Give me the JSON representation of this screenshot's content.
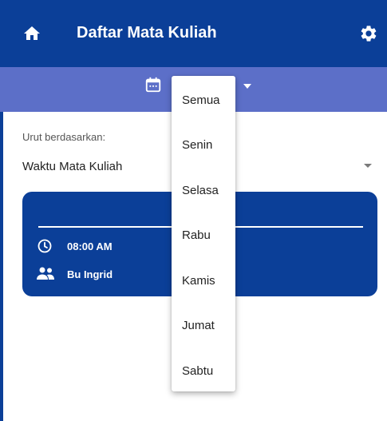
{
  "appbar": {
    "title": "Daftar Mata Kuliah",
    "home_icon": "home-icon",
    "settings_icon": "gear-icon"
  },
  "filter": {
    "icon": "calendar-icon",
    "selected_day": ""
  },
  "sort": {
    "label": "Urut berdasarkan:",
    "value": "Waktu Mata Kuliah"
  },
  "course_card": {
    "time": "08:00 AM",
    "lecturer": "Bu Ingrid",
    "time_icon": "clock-icon",
    "lecturer_icon": "people-icon"
  },
  "day_menu": {
    "items": [
      "Semua",
      "Senin",
      "Selasa",
      "Rabu",
      "Kamis",
      "Jumat",
      "Sabtu"
    ]
  },
  "colors": {
    "primary": "#0b3f98",
    "secondary": "#5c6fc8",
    "surface": "#ffffff"
  }
}
